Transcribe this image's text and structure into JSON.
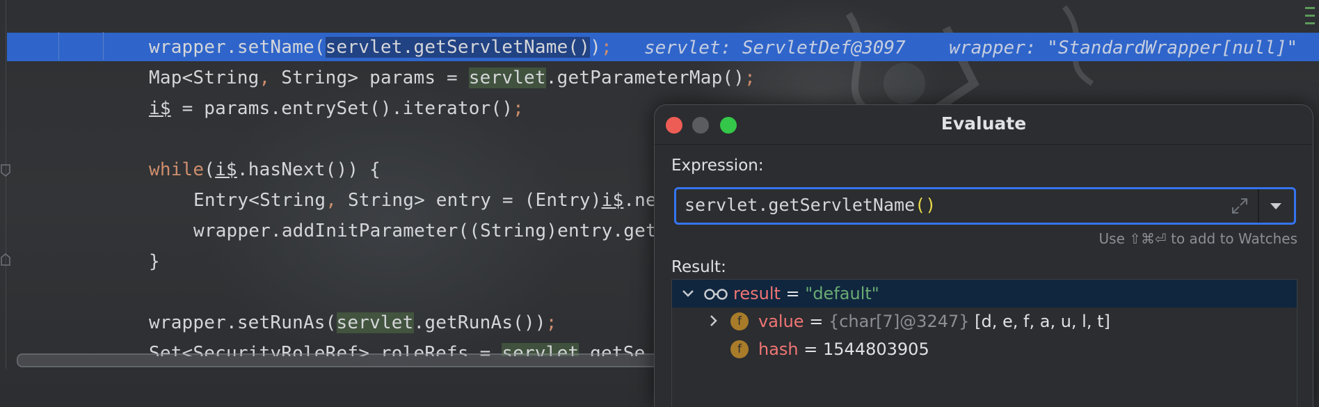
{
  "editor": {
    "line1": {
      "pre": "wrapper.setName(",
      "sel": "servlet.getServletName()",
      "post": ")",
      "semi": ";"
    },
    "inline_hint": "servlet: ServletDef@3097    wrapper: \"StandardWrapper[null]\"",
    "line2": {
      "a": "Map<String",
      "comma": ",",
      "b": " String> params = ",
      "hl": "servlet",
      "c": ".getParameterMap()",
      "semi": ";"
    },
    "line3": {
      "var": "i$",
      "a": " = params.entrySet().iterator()",
      "semi": ";"
    },
    "line5": {
      "kw": "while",
      "a": "(",
      "var": "i$",
      "b": ".hasNext()) {"
    },
    "line6": {
      "a": "Entry<String",
      "comma": ",",
      "b": " String> entry = (Entry)",
      "var": "i$",
      "c": ".ne"
    },
    "line7": "wrapper.addInitParameter((String)entry.get",
    "line8": "}",
    "line10": {
      "a": "wrapper.setRunAs(",
      "hl": "servlet",
      "b": ".getRunAs())",
      "semi": ";"
    },
    "line11": {
      "a": "Set<SecurityRoleRef> roleRefs = ",
      "hl": "servlet",
      "b": ".getSe"
    }
  },
  "dialog": {
    "title": "Evaluate",
    "expression_label": "Expression:",
    "expression_value": "servlet.getServletName",
    "expression_parens": "()",
    "watch_hint": "Use ⇧⌘⏎ to add to Watches",
    "result_label": "Result:",
    "rows": [
      {
        "name": "result",
        "eq": " = ",
        "value": "\"default\"",
        "icon": "glasses-icon"
      },
      {
        "name": "value",
        "eq": " = ",
        "type": "{char[7]@3247}",
        "value": " [d, e, f, a, u, l, t]",
        "icon": "field-icon",
        "badge": "f"
      },
      {
        "name": "hash",
        "eq": " = ",
        "value": "1544803905",
        "icon": "field-icon",
        "badge": "f"
      }
    ]
  },
  "colors": {
    "current_line": "#2f65ca",
    "dialog_bg": "#2b2d30",
    "focus_border": "#3574f0",
    "field_name": "#f07575",
    "string_value": "#6aab73"
  }
}
